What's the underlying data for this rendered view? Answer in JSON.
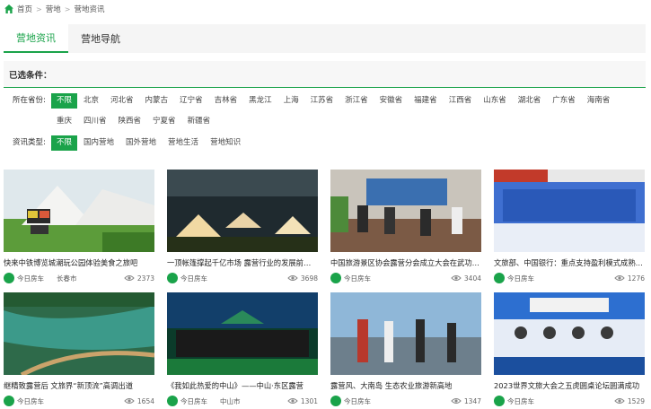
{
  "breadcrumb": [
    "首页",
    "营地",
    "营地资讯"
  ],
  "tabs": [
    {
      "label": "营地资讯",
      "active": true
    },
    {
      "label": "营地导航",
      "active": false
    }
  ],
  "filters": {
    "selected_label": "已选条件：",
    "province_label": "所在省份:",
    "provinces": [
      "不限",
      "北京",
      "河北省",
      "内蒙古",
      "辽宁省",
      "吉林省",
      "黑龙江",
      "上海",
      "江苏省",
      "浙江省",
      "安徽省",
      "福建省",
      "江西省",
      "山东省",
      "湖北省",
      "广东省",
      "海南省",
      "重庆",
      "四川省",
      "陕西省",
      "宁夏省",
      "新疆省"
    ],
    "type_label": "资讯类型:",
    "types": [
      "不限",
      "国内营地",
      "国外营地",
      "营地生活",
      "营地知识"
    ]
  },
  "colors": {
    "accent": "#1aa34a"
  },
  "cards": [
    {
      "title": "快来中铁博览城潮玩公园体验美食之旅吧",
      "source": "今日房车",
      "location": "长春市",
      "views": "2373"
    },
    {
      "title": "一顶帐篷撑起千亿市场 露营行业的发展前景如何",
      "source": "今日房车",
      "location": "",
      "views": "3698"
    },
    {
      "title": "中国旅游景区协会露营分会成立大会在武功山召开",
      "source": "今日房车",
      "location": "",
      "views": "3404"
    },
    {
      "title": "文旅部、中国银行：重点支持盈利模式成熟的露营地",
      "source": "今日房车",
      "location": "",
      "views": "1276"
    },
    {
      "title": "继精致露营后 文旅界“新顶流”高调出道",
      "source": "今日房车",
      "location": "",
      "views": "1654"
    },
    {
      "title": "《我如此热爱的中山》——中山·东区露营",
      "source": "今日房车",
      "location": "中山市",
      "views": "1301"
    },
    {
      "title": "露营风、大南岛 生态农业旅游新高地",
      "source": "今日房车",
      "location": "",
      "views": "1347"
    },
    {
      "title": "2023世界文旅大会之五虎圆桌论坛圆满成功",
      "source": "今日房车",
      "location": "",
      "views": "1529"
    }
  ]
}
